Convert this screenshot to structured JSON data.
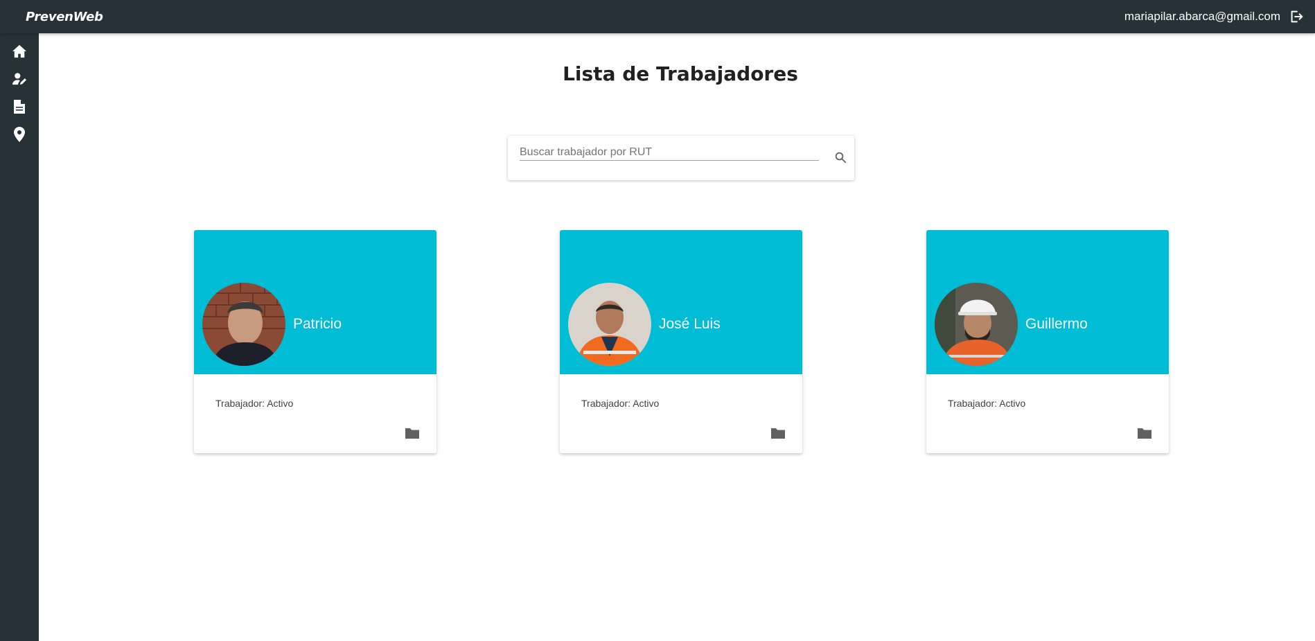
{
  "app": {
    "brand": "PrevenWeb"
  },
  "header": {
    "user_email": "mariapilar.abarca@gmail.com",
    "logout_icon": "logout-icon"
  },
  "sidebar": {
    "items": [
      {
        "icon": "home-icon"
      },
      {
        "icon": "worker-edit-icon"
      },
      {
        "icon": "document-icon"
      },
      {
        "icon": "location-pin-icon"
      }
    ]
  },
  "main": {
    "title": "Lista de Trabajadores",
    "search": {
      "placeholder": "Buscar trabajador por RUT",
      "value": "",
      "icon": "search-icon"
    },
    "workers": [
      {
        "name": "Patricio",
        "status": "Trabajador: Activo"
      },
      {
        "name": "José Luis",
        "status": "Trabajador: Activo"
      },
      {
        "name": "Guillermo",
        "status": "Trabajador: Activo"
      }
    ]
  },
  "colors": {
    "topbar": "#263238",
    "card_header": "#00bcd4",
    "icon_gray": "#616161"
  }
}
